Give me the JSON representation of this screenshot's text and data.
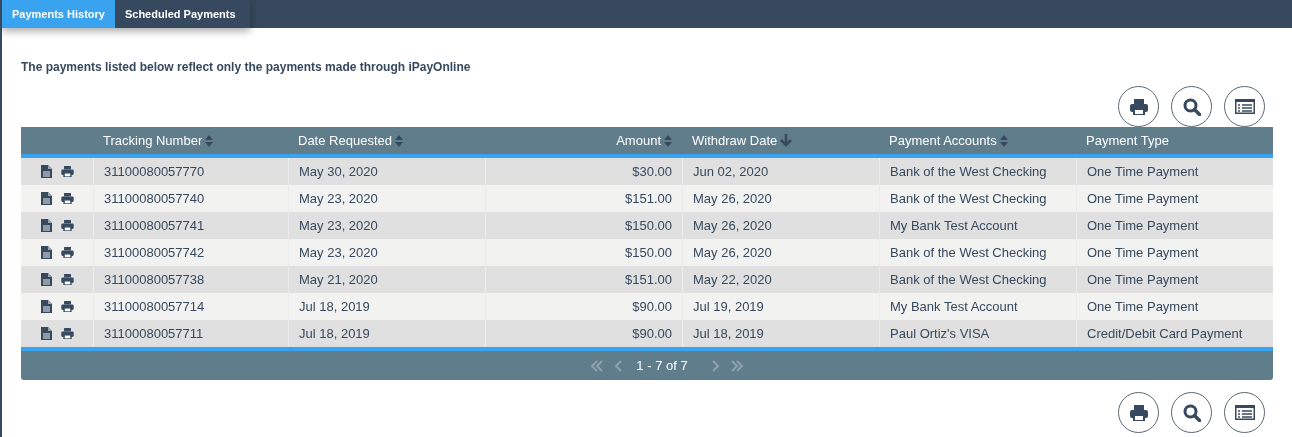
{
  "tabs": [
    {
      "label": "Payments History",
      "selected": true
    },
    {
      "label": "Scheduled Payments",
      "selected": false
    }
  ],
  "notice": "The payments listed below reflect only the payments made through iPayOnline",
  "table": {
    "columns": [
      {
        "label": "Tracking Number",
        "sortable": true,
        "sorted": false,
        "numeric": false
      },
      {
        "label": "Date Requested",
        "sortable": true,
        "sorted": false,
        "numeric": false
      },
      {
        "label": "Amount",
        "sortable": true,
        "sorted": false,
        "numeric": true
      },
      {
        "label": "Withdraw Date",
        "sortable": true,
        "sorted": true,
        "numeric": false
      },
      {
        "label": "Payment Accounts",
        "sortable": true,
        "sorted": false,
        "numeric": false
      },
      {
        "label": "Payment Type",
        "sortable": false,
        "sorted": false,
        "numeric": false
      }
    ],
    "rows": [
      [
        "31100080057770",
        "May 30, 2020",
        "$30.00",
        "Jun 02, 2020",
        "Bank of the West Checking",
        "One Time Payment"
      ],
      [
        "31100080057740",
        "May 23, 2020",
        "$151.00",
        "May 26, 2020",
        "Bank of the West Checking",
        "One Time Payment"
      ],
      [
        "31100080057741",
        "May 23, 2020",
        "$150.00",
        "May 26, 2020",
        "My Bank Test Account",
        "One Time Payment"
      ],
      [
        "31100080057742",
        "May 23, 2020",
        "$150.00",
        "May 26, 2020",
        "Bank of the West Checking",
        "One Time Payment"
      ],
      [
        "31100080057738",
        "May 21, 2020",
        "$151.00",
        "May 22, 2020",
        "Bank of the West Checking",
        "One Time Payment"
      ],
      [
        "31100080057714",
        "Jul 18, 2019",
        "$90.00",
        "Jul 19, 2019",
        "My Bank Test Account",
        "One Time Payment"
      ],
      [
        "31100080057711",
        "Jul 18, 2019",
        "$90.00",
        "Jul 18, 2019",
        "Paul Ortiz's VISA",
        "Credit/Debit Card Payment"
      ]
    ],
    "pager": "1 - 7 of 7"
  }
}
